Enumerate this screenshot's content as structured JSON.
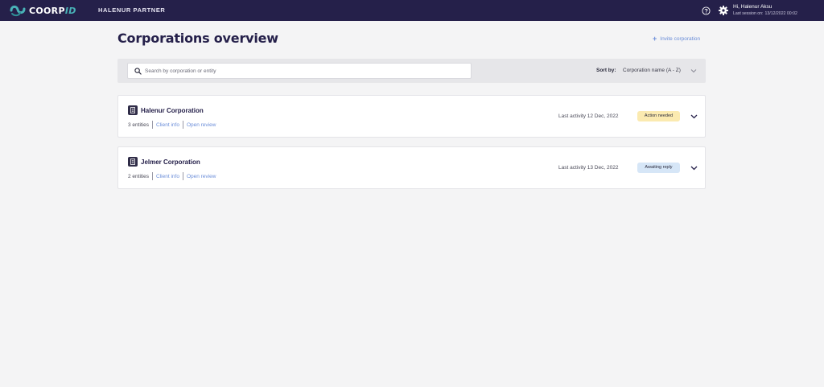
{
  "header": {
    "logo_main": "COORP",
    "logo_accent": "ID",
    "partner_name": "HALENUR PARTNER",
    "user_greeting": "Hi, Halenur Aksu",
    "last_session_label": "Last session on:",
    "last_session_value": "13/12/2022 00:02",
    "help_icon": "question-circle-icon",
    "settings_icon": "gear-icon"
  },
  "main": {
    "title": "Corporations overview",
    "invite_label": "Invite corporation",
    "search": {
      "placeholder": "Search by corporation or entity",
      "value": ""
    },
    "sort": {
      "label": "Sort by:",
      "selected": "Corporation name (A - Z)"
    },
    "corporations": [
      {
        "name": "Halenur Corporation",
        "entities": "3 entities",
        "client_info": "Client info",
        "open_review": "Open review",
        "last_activity": "Last activity 12 Dec, 2022",
        "status": "Action needed",
        "status_color": "#fbeab0"
      },
      {
        "name": "Jelmer Corporation",
        "entities": "2 entities",
        "client_info": "Client info",
        "open_review": "Open review",
        "last_activity": "Last activity 13 Dec, 2022",
        "status": "Awaiting reply",
        "status_color": "#d6e6f7"
      }
    ]
  },
  "colors": {
    "topbar": "#25204a",
    "accent": "#49b3b8",
    "link": "#6b8ed9",
    "background": "#f4f4f5"
  }
}
